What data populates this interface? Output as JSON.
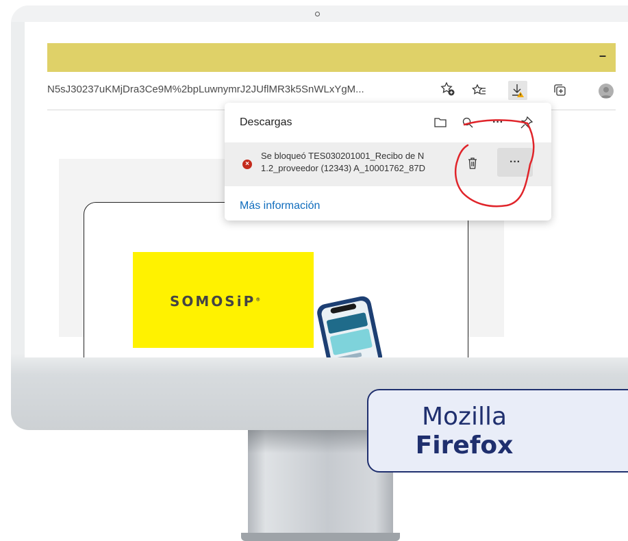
{
  "browser": {
    "url_text": "N5sJ30237uKMjDra3Ce9M%2bpLuwnymrJ2JUflMR3k5SnWLxYgM...",
    "minimize_label": "–",
    "icons": [
      "add-favorite-icon",
      "favorites-icon",
      "downloads-icon",
      "collections-icon",
      "profile-icon"
    ]
  },
  "downloads_panel": {
    "title": "Descargas",
    "icons": [
      "folder-icon",
      "search-icon",
      "more-icon",
      "pin-icon"
    ],
    "more_label": "···",
    "item": {
      "line1": "Se bloqueó TES030201001_Recibo de N",
      "line2": "1.2_proveedor (12343) A_10001762_87D",
      "more_label": "···"
    },
    "more_info": "Más información"
  },
  "page": {
    "logo_text": "SOMOSiP",
    "logo_mark": "®"
  },
  "callout": {
    "line1": "Mozilla",
    "line2": "Firefox"
  },
  "colors": {
    "titlebar": "#dfd168",
    "link": "#0f6cbd",
    "error": "#c42b1c",
    "callout_text": "#1f2f6e",
    "callout_bg": "#e9edf8",
    "annotation": "#e0242a",
    "page_yellow": "#fff200"
  }
}
